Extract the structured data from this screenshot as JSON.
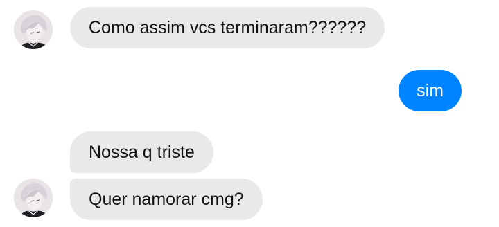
{
  "conversation": {
    "messages": [
      {
        "sender": "contact",
        "text": "Como assim vcs terminaram??????"
      },
      {
        "sender": "me",
        "text": "sim"
      },
      {
        "sender": "contact",
        "text": "Nossa q triste"
      },
      {
        "sender": "contact",
        "text": "Quer namorar cmg?"
      }
    ],
    "colors": {
      "incoming_bubble": "#e9e9eb",
      "outgoing_bubble": "#0084ff",
      "incoming_text": "#121212",
      "outgoing_text": "#ffffff"
    },
    "icons": {
      "avatar": "contact-avatar-icon"
    }
  }
}
